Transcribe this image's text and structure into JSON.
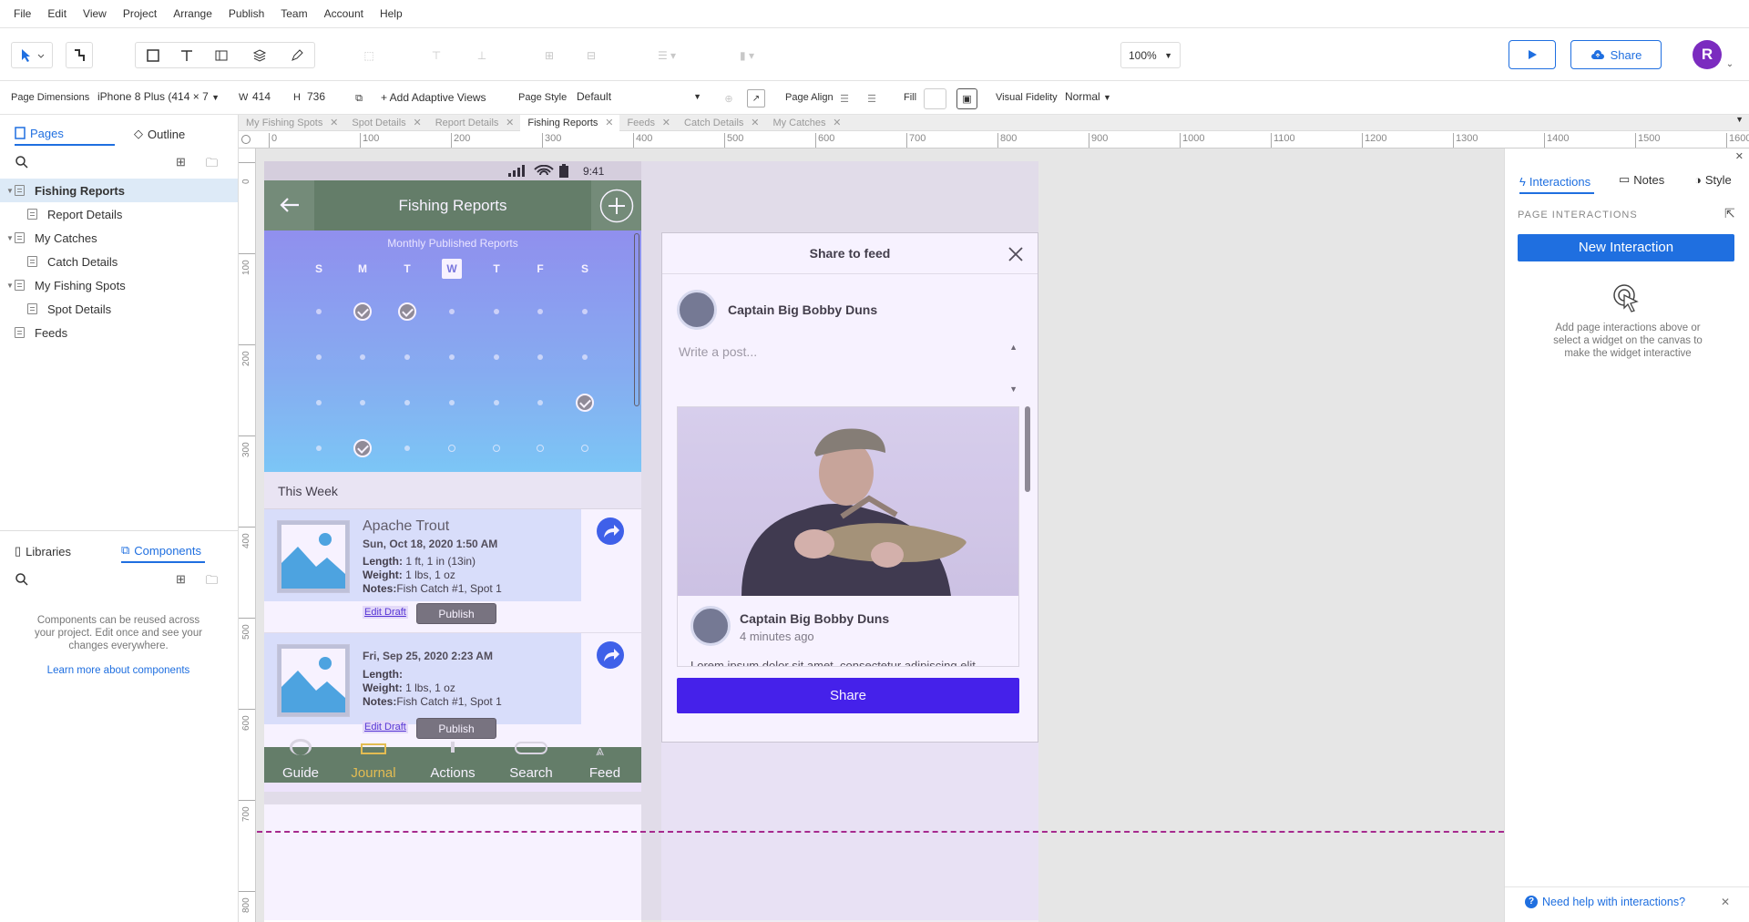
{
  "menu": [
    "File",
    "Edit",
    "View",
    "Project",
    "Arrange",
    "Publish",
    "Team",
    "Account",
    "Help"
  ],
  "toolbar": {
    "zoom": "100%",
    "preview_label": "",
    "share_label": "Share",
    "avatar_initial": "R"
  },
  "props": {
    "page_dimensions_label": "Page Dimensions",
    "device": "iPhone 8 Plus  (414 × 7",
    "w_label": "W",
    "w_value": "414",
    "h_label": "H",
    "h_value": "736",
    "adaptive_label": "+ Add Adaptive Views",
    "page_style_label": "Page Style",
    "page_style_value": "Default",
    "page_align_label": "Page Align",
    "fill_label": "Fill",
    "fidelity_label": "Visual Fidelity",
    "fidelity_value": "Normal"
  },
  "tabs": [
    "My Fishing Spots",
    "Spot Details",
    "Report Details",
    "Fishing Reports",
    "Feeds",
    "Catch Details",
    "My Catches"
  ],
  "left": {
    "pages_tab": "Pages",
    "outline_tab": "Outline",
    "tree": [
      "Fishing Reports",
      "Report Details",
      "My Catches",
      "Catch Details",
      "My Fishing Spots",
      "Spot Details",
      "Feeds"
    ],
    "libraries_tab": "Libraries",
    "components_tab": "Components",
    "components_help": "Components can be reused across your project. Edit once and see your changes everywhere.",
    "learn_more": "Learn more about components"
  },
  "ruler": {
    "h": [
      "0",
      "100",
      "200",
      "300",
      "400",
      "500",
      "600",
      "700",
      "800",
      "900",
      "1000",
      "1100",
      "1200",
      "1300",
      "1400",
      "1500",
      "1600"
    ],
    "v": [
      "0",
      "100",
      "200",
      "300",
      "400",
      "500",
      "600",
      "700",
      "800"
    ]
  },
  "phone": {
    "time": "9:41",
    "title": "Fishing Reports",
    "calendar_title": "Monthly Published Reports",
    "days": [
      "S",
      "M",
      "T",
      "W",
      "T",
      "F",
      "S"
    ],
    "section": "This Week",
    "reports": [
      {
        "title": "Apache Trout",
        "date": "Sun, Oct 18, 2020 1:50 AM",
        "length_label": "Length:",
        "length": " 1 ft, 1 in (13in)",
        "weight_label": "Weight:",
        "weight": " 1 lbs, 1 oz",
        "notes_label": "Notes:",
        "notes": "Fish Catch #1, Spot 1",
        "edit": "Edit Draft",
        "publish": "Publish"
      },
      {
        "title": "",
        "date": "Fri, Sep 25, 2020 2:23 AM",
        "length_label": "Length:",
        "length": "",
        "weight_label": "Weight:",
        "weight": " 1 lbs, 1 oz",
        "notes_label": "Notes:",
        "notes": "Fish Catch #1, Spot 1",
        "edit": "Edit Draft",
        "publish": "Publish"
      }
    ],
    "nav": [
      "Guide",
      "Journal",
      "Actions",
      "Search",
      "Feed"
    ]
  },
  "share": {
    "title": "Share to feed",
    "user": "Captain Big Bobby Duns",
    "placeholder": "Write a post...",
    "post_user": "Captain Big Bobby Duns",
    "post_time": "4 minutes ago",
    "post_text": "Lorem ipsum dolor sit amet, consectetur adipiscing elit",
    "button": "Share"
  },
  "right": {
    "tabs": [
      "Interactions",
      "Notes",
      "Style"
    ],
    "section": "PAGE INTERACTIONS",
    "new_btn": "New Interaction",
    "help": "Add page interactions above or select a widget on the canvas to make the widget interactive",
    "need_help": "Need help with interactions?"
  },
  "colors": {
    "accent": "#1f6fe0",
    "share_btn": "#3512e8",
    "nav_green": "#587a55",
    "journal_yellow": "#e9c23b"
  }
}
